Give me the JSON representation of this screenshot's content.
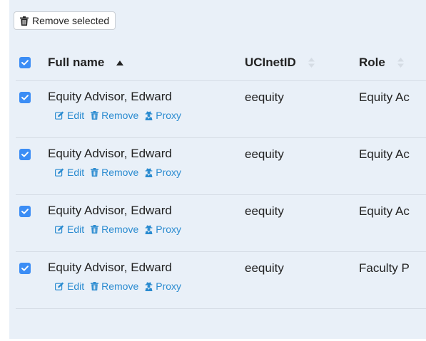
{
  "toolbar": {
    "remove_selected_label": "Remove selected"
  },
  "table": {
    "headers": {
      "full_name": "Full name",
      "ucinetid": "UCInetID",
      "role": "Role"
    },
    "select_all_checked": true,
    "rows": [
      {
        "checked": true,
        "full_name": "Equity Advisor, Edward",
        "ucinetid": "eequity",
        "role": "Equity Ac",
        "actions": {
          "edit": "Edit",
          "remove": "Remove",
          "proxy": "Proxy"
        }
      },
      {
        "checked": true,
        "full_name": "Equity Advisor, Edward",
        "ucinetid": "eequity",
        "role": "Equity Ac",
        "actions": {
          "edit": "Edit",
          "remove": "Remove",
          "proxy": "Proxy"
        }
      },
      {
        "checked": true,
        "full_name": "Equity Advisor, Edward",
        "ucinetid": "eequity",
        "role": "Equity Ac",
        "actions": {
          "edit": "Edit",
          "remove": "Remove",
          "proxy": "Proxy"
        }
      },
      {
        "checked": true,
        "full_name": "Equity Advisor, Edward",
        "ucinetid": "eequity",
        "role": "Faculty P",
        "actions": {
          "edit": "Edit",
          "remove": "Remove",
          "proxy": "Proxy"
        }
      }
    ]
  },
  "colors": {
    "accent": "#3b8df5",
    "link": "#2a8bd0",
    "panel_bg": "#e9f0f8"
  },
  "icons": {
    "trash": "trash-icon",
    "edit": "edit-icon",
    "proxy": "user-secret-icon",
    "sort_active": "sort-up-icon",
    "sort_inactive": "sort-icon",
    "check": "check-icon"
  }
}
